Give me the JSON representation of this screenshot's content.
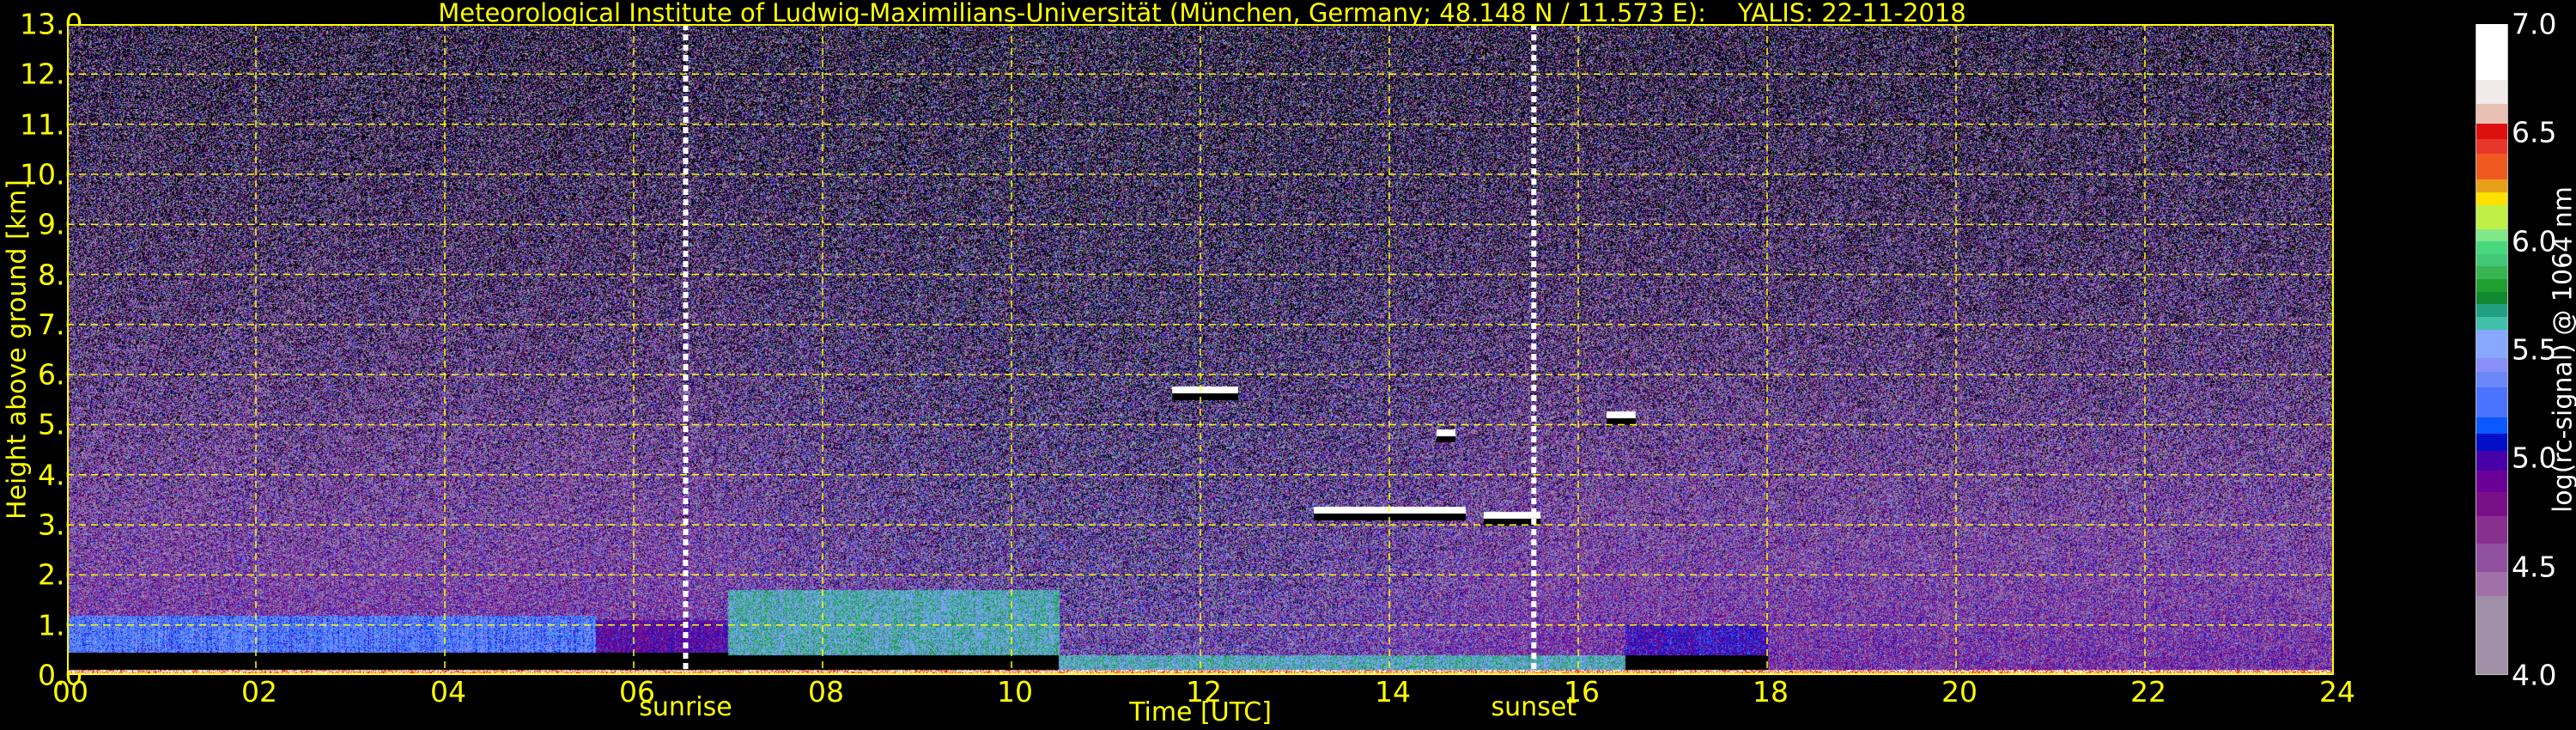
{
  "chart_data": {
    "type": "heatmap",
    "title": "Meteorological Institute of Ludwig-Maximilians-Universität (München, Germany; 48.148 N / 11.573 E):    YALIS: 22-11-2018",
    "xlabel": "Time [UTC]",
    "ylabel": "Height above ground [km]",
    "xlim": [
      0,
      24
    ],
    "ylim": [
      0,
      13
    ],
    "xticks": [
      "00",
      "02",
      "04",
      "06",
      "08",
      "10",
      "12",
      "14",
      "16",
      "18",
      "20",
      "22",
      "24"
    ],
    "xtick_values": [
      0,
      2,
      4,
      6,
      8,
      10,
      12,
      14,
      16,
      18,
      20,
      22,
      24
    ],
    "yticks": [
      "0.0",
      "1.0",
      "2.0",
      "3.0",
      "4.0",
      "5.0",
      "6.0",
      "7.0",
      "8.0",
      "9.0",
      "10.0",
      "11.0",
      "12.0",
      "13.0"
    ],
    "ytick_values": [
      0,
      1,
      2,
      3,
      4,
      5,
      6,
      7,
      8,
      9,
      10,
      11,
      12,
      13
    ],
    "grid": true,
    "grid_color": "#ffff00",
    "events": [
      {
        "label": "sunrise",
        "time": 6.55
      },
      {
        "label": "sunset",
        "time": 15.53
      }
    ],
    "colorbar": {
      "label": "log(rc-signal) @ 1064 nm",
      "range": [
        4.0,
        7.0
      ],
      "ticks": [
        "4.0",
        "4.5",
        "5.0",
        "5.5",
        "6.0",
        "6.5",
        "7.0"
      ],
      "tick_values": [
        4.0,
        4.5,
        5.0,
        5.5,
        6.0,
        6.5,
        7.0
      ],
      "bounds": [
        4.0,
        4.361,
        4.472,
        4.605,
        4.729,
        4.841,
        4.94,
        5.03,
        5.11,
        5.187,
        5.326,
        5.395,
        5.459,
        5.592,
        5.652,
        5.71,
        5.766,
        5.824,
        5.884,
        5.942,
        6.0,
        6.056,
        6.167,
        6.227,
        6.285,
        6.403,
        6.472,
        6.543,
        6.635,
        6.747,
        7.0
      ],
      "colors": [
        "#a090a8",
        "#a070a8",
        "#9050a0",
        "#883090",
        "#7a1088",
        "#6a0098",
        "#4800a8",
        "#0010c8",
        "#0a58ff",
        "#4a74ff",
        "#6a88f8",
        "#8890f8",
        "#88a8ff",
        "#40c0a8",
        "#20a080",
        "#108830",
        "#20a030",
        "#38b450",
        "#40c878",
        "#48d880",
        "#80e888",
        "#c0f048",
        "#ffe000",
        "#e8a018",
        "#f05a20",
        "#e8362a",
        "#dd1010",
        "#e8c0b4",
        "#f0eaea",
        "#ffffff"
      ]
    },
    "features": [
      {
        "kind": "aerosol-layer",
        "from": 0,
        "to": 5.6,
        "base_km": 0.45,
        "top_km": 1.2,
        "level": 5.3
      },
      {
        "kind": "aerosol-layer",
        "from": 5.6,
        "to": 7.0,
        "base_km": 0.45,
        "top_km": 1.1,
        "level": 4.9
      },
      {
        "kind": "aerosol-layer",
        "from": 7.0,
        "to": 10.5,
        "base_km": 0.4,
        "top_km": 1.7,
        "level": 5.6
      },
      {
        "kind": "aerosol-layer",
        "from": 10.5,
        "to": 16.5,
        "base_km": 0.0,
        "top_km": 0.4,
        "level": 5.6
      },
      {
        "kind": "aerosol-layer",
        "from": 16.5,
        "to": 18.0,
        "base_km": 0.4,
        "top_km": 1.0,
        "level": 5.0
      },
      {
        "kind": "cloud",
        "from": 13.2,
        "to": 14.8,
        "height_km": 3.3
      },
      {
        "kind": "cloud",
        "from": 15.0,
        "to": 15.6,
        "height_km": 3.2
      },
      {
        "kind": "cloud",
        "from": 11.7,
        "to": 12.4,
        "height_km": 5.7
      },
      {
        "kind": "cloud",
        "from": 14.5,
        "to": 14.7,
        "height_km": 4.85
      },
      {
        "kind": "cloud",
        "from": 16.3,
        "to": 16.6,
        "height_km": 5.2
      }
    ]
  }
}
